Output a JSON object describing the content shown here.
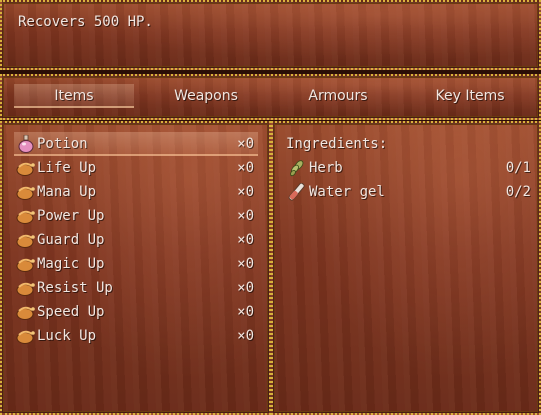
{
  "help_text": "Recovers 500 HP.",
  "tabs": [
    {
      "label": "Items",
      "selected": true
    },
    {
      "label": "Weapons",
      "selected": false
    },
    {
      "label": "Armours",
      "selected": false
    },
    {
      "label": "Key Items",
      "selected": false
    }
  ],
  "items": [
    {
      "name": "Potion",
      "qty": "×0",
      "icon": "potion-flask-icon"
    },
    {
      "name": "Life Up",
      "qty": "×0",
      "icon": "pouch-icon"
    },
    {
      "name": "Mana Up",
      "qty": "×0",
      "icon": "pouch-icon"
    },
    {
      "name": "Power Up",
      "qty": "×0",
      "icon": "pouch-icon"
    },
    {
      "name": "Guard Up",
      "qty": "×0",
      "icon": "pouch-icon"
    },
    {
      "name": "Magic Up",
      "qty": "×0",
      "icon": "pouch-icon"
    },
    {
      "name": "Resist Up",
      "qty": "×0",
      "icon": "pouch-icon"
    },
    {
      "name": "Speed Up",
      "qty": "×0",
      "icon": "pouch-icon"
    },
    {
      "name": "Luck Up",
      "qty": "×0",
      "icon": "pouch-icon"
    }
  ],
  "ingredients": {
    "title": "Ingredients:",
    "list": [
      {
        "name": "Herb",
        "count": "0/1",
        "icon": "herb-icon"
      },
      {
        "name": "Water gel",
        "count": "0/2",
        "icon": "vial-icon"
      }
    ]
  },
  "colors": {
    "frame": "#d8b33c",
    "panel": "#7e3520",
    "text": "#f2e6e0"
  }
}
